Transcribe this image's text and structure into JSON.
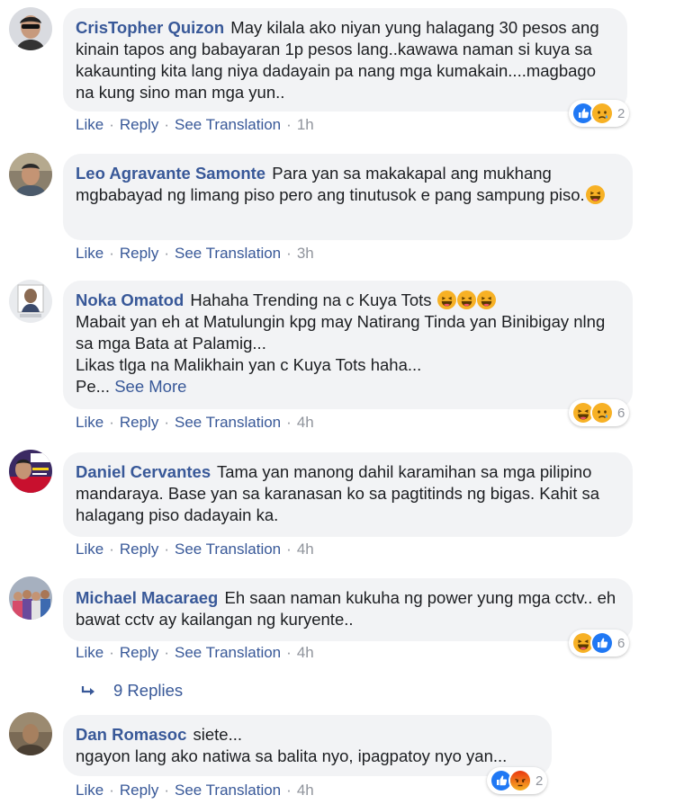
{
  "comments": [
    {
      "author": "CrisTopher Quizon",
      "text": "May kilala ako niyan yung halagang 30 pesos ang kinain tapos ang babayaran 1p pesos lang..kawawa naman si kuya sa kakaunting kita lang niya dadayain pa nang mga kumakain....magbago na kung sino man mga yun..",
      "like": "Like",
      "reply": "Reply",
      "see_translation": "See Translation",
      "time": "1h",
      "reactions": [
        "like-icon",
        "sad-icon"
      ],
      "reaction_count": "2"
    },
    {
      "author": "Leo Agravante Samonte",
      "text": "Para yan sa makakapal ang mukhang mgbabayad ng limang piso pero ang tinutusok e pang sampung piso.",
      "like": "Like",
      "reply": "Reply",
      "see_translation": "See Translation",
      "time": "3h"
    },
    {
      "author": "Noka Omatod",
      "text_line1": "Hahaha Trending na c Kuya Tots",
      "text_rest": "Mabait yan eh at Matulungin kpg may Natirang Tinda yan Binibigay nlng sa mga Bata at Palamig...\nLikas tlga na Malikhain yan c Kuya Tots haha...\nPe...",
      "see_more": "See More",
      "like": "Like",
      "reply": "Reply",
      "see_translation": "See Translation",
      "time": "4h",
      "reactions": [
        "haha-icon",
        "sad-icon"
      ],
      "reaction_count": "6"
    },
    {
      "author": "Daniel Cervantes",
      "text": "Tama yan manong dahil karamihan sa mga pilipino mandaraya. Base yan sa karanasan ko sa pagtitinds ng bigas. Kahit sa halagang piso dadayain ka.",
      "like": "Like",
      "reply": "Reply",
      "see_translation": "See Translation",
      "time": "4h"
    },
    {
      "author": "Michael Macaraeg",
      "text": "Eh saan naman kukuha ng power yung mga cctv.. eh bawat cctv ay kailangan ng kuryente..",
      "like": "Like",
      "reply": "Reply",
      "see_translation": "See Translation",
      "time": "4h",
      "reactions": [
        "haha-icon",
        "like-icon"
      ],
      "reaction_count": "6"
    },
    {
      "author": "Dan Romasoc",
      "text": "siete...\nngayon lang ako natiwa sa balita nyo, ipagpatoy nyo yan...",
      "like": "Like",
      "reply": "Reply",
      "see_translation": "See Translation",
      "time": "4h",
      "reactions": [
        "like-icon",
        "angry-icon"
      ],
      "reaction_count": "2"
    }
  ],
  "replies_link": "9 Replies",
  "colors": {
    "link": "#385898",
    "bubble": "#f2f3f5",
    "meta": "#90949c",
    "like_blue": "#2078f4",
    "emoji_yellow": "#f7b125",
    "angry_red": "#e9710f"
  }
}
